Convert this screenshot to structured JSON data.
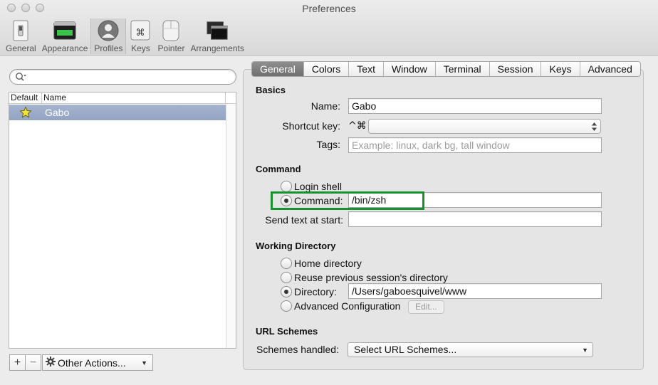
{
  "window": {
    "title": "Preferences"
  },
  "toolbar": {
    "items": [
      {
        "label": "General",
        "icon": "general-switch-icon"
      },
      {
        "label": "Appearance",
        "icon": "appearance-icon"
      },
      {
        "label": "Profiles",
        "icon": "profiles-person-icon",
        "active": true
      },
      {
        "label": "Keys",
        "icon": "keys-command-icon"
      },
      {
        "label": "Pointer",
        "icon": "pointer-mouse-icon"
      },
      {
        "label": "Arrangements",
        "icon": "arrangements-windows-icon"
      }
    ]
  },
  "profiles": {
    "search_placeholder": "",
    "columns": [
      "Default",
      "Name"
    ],
    "rows": [
      {
        "default": true,
        "name": "Gabo",
        "selected": true
      }
    ],
    "add_label": "+",
    "remove_label": "−",
    "actions_label": "Other Actions..."
  },
  "tabs": [
    "General",
    "Colors",
    "Text",
    "Window",
    "Terminal",
    "Session",
    "Keys",
    "Advanced"
  ],
  "active_tab": "General",
  "basics": {
    "title": "Basics",
    "name_label": "Name:",
    "name_value": "Gabo",
    "shortcut_label": "Shortcut key:",
    "shortcut_prefix": "^⌘",
    "shortcut_value": "",
    "tags_label": "Tags:",
    "tags_placeholder": "Example: linux, dark bg, tall window"
  },
  "command": {
    "title": "Command",
    "login_shell_label": "Login shell",
    "command_label": "Command:",
    "command_value": "/bin/zsh",
    "selected": "command",
    "send_text_label": "Send text at start:",
    "send_text_value": ""
  },
  "working_directory": {
    "title": "Working Directory",
    "home_label": "Home directory",
    "reuse_label": "Reuse previous session's directory",
    "directory_label": "Directory:",
    "directory_value": "/Users/gaboesquivel/www",
    "advanced_label": "Advanced Configuration",
    "edit_label": "Edit...",
    "selected": "directory"
  },
  "url_schemes": {
    "title": "URL Schemes",
    "schemes_label": "Schemes handled:",
    "schemes_value": "Select URL Schemes..."
  },
  "colors": {
    "highlight": "#17922e",
    "selected_row": "#9aa9c7",
    "active_tab": "#7f7f7f"
  }
}
